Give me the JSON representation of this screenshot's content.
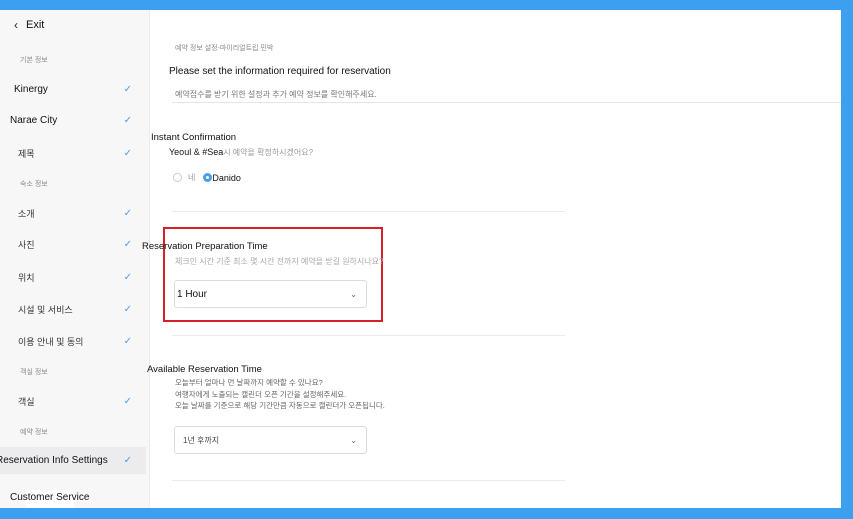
{
  "sidebar": {
    "exit_label": "Exit",
    "sections": [
      "기본 정보",
      "숙소 정보",
      "객실 정보",
      "예약 정보"
    ],
    "items": [
      {
        "label": "Kinergy",
        "checked": true
      },
      {
        "label": "Narae City",
        "checked": true
      },
      {
        "label": "제목",
        "checked": true
      },
      {
        "label": "소개",
        "checked": true
      },
      {
        "label": "사진",
        "checked": true
      },
      {
        "label": "위치",
        "checked": true
      },
      {
        "label": "시설 및 서비스",
        "checked": true
      },
      {
        "label": "이용 안내 및 동의",
        "checked": true
      },
      {
        "label": "객실",
        "checked": true
      },
      {
        "label": "Reservation Info Settings",
        "checked": true
      }
    ],
    "customer_service": "Customer Service",
    "check_icon": "✓"
  },
  "main": {
    "breadcrumb": "예약 정보 설정-마이리얼트립 민박",
    "title": "Please set the information required for reservation",
    "description": "예약접수를 받기 위한 설정과 추가 예약 정보를 확인해주세요.",
    "instant": {
      "title": "Instant Confirmation",
      "question_strong": "Yeoul & #Sea",
      "question_rest": "시 예약을 확정하시겠어요?",
      "option_yes": "네",
      "option_selected": "Danido"
    },
    "prep": {
      "title": "Reservation Preparation Time",
      "question": "체크인 시간 기준 최소 몇 시간 전까지 예약을 받길 원하시나요?",
      "value": "1 Hour"
    },
    "available": {
      "title": "Available Reservation Time",
      "lines": [
        "오늘부터 얼마나 먼 날짜까지 예약할 수 있나요?",
        "여행자에게 노출되는 캘린더 오픈 기간을 설정해주세요.",
        "오늘 날짜를 기준으로 해당 기간만큼 자동으로 캘린더가 오픈됩니다."
      ],
      "value": "1년 후까지"
    }
  },
  "colors": {
    "accent": "#4a9de8",
    "highlight": "#d81f26",
    "background": "#3d9ff0"
  }
}
